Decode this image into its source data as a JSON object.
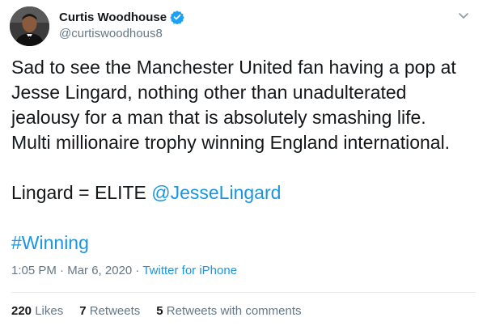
{
  "author": {
    "display_name": "Curtis Woodhouse",
    "handle": "@curtiswoodhous8",
    "verified": true
  },
  "tweet": {
    "lines": [
      "Sad to see the Manchester United fan having a pop at",
      "Jesse Lingard, nothing other than unadulterated",
      "jealousy for a man that is absolutely smashing life.",
      "Multi millionaire trophy winning England international."
    ],
    "elite_text": "Lingard = ELITE ",
    "mention": "@JesseLingard",
    "hashtag": "#Winning"
  },
  "meta": {
    "time": "1:05 PM",
    "date": "Mar 6, 2020",
    "separator": " · ",
    "source": "Twitter for iPhone"
  },
  "stats": {
    "likes_count": "220",
    "likes_label": " Likes",
    "retweets_count": "7",
    "retweets_label": " Retweets",
    "comments_count": "5",
    "comments_label": " Retweets with comments"
  },
  "colors": {
    "link": "#1b95e0",
    "text": "#14171a",
    "muted": "#657786",
    "divider": "#e6ecf0"
  },
  "icons": {
    "verified": "verified-badge-icon",
    "menu": "chevron-down-icon"
  }
}
